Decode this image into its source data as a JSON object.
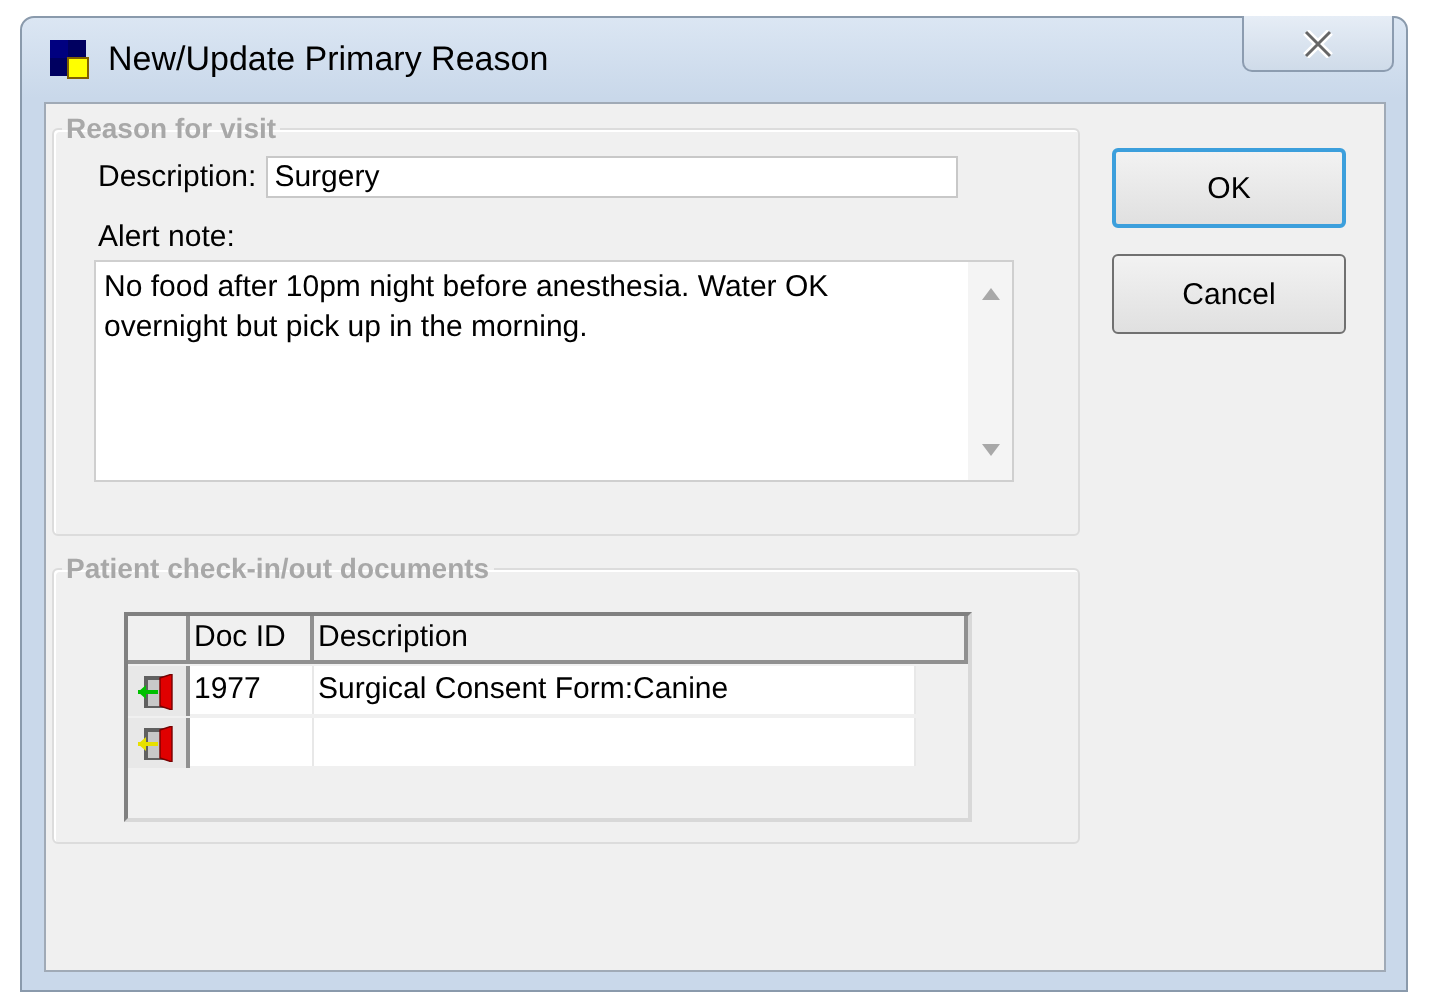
{
  "window": {
    "title": "New/Update Primary Reason"
  },
  "reason_group": {
    "title": "Reason for visit",
    "description_label": "Description:",
    "description_value": "Surgery",
    "alert_label": "Alert note:",
    "alert_value": "No food after 10pm night before anesthesia. Water OK overnight but pick up in the morning."
  },
  "documents_group": {
    "title": "Patient check-in/out documents",
    "table": {
      "columns": [
        "Doc ID",
        "Description"
      ],
      "rows": [
        {
          "color": "#00c000",
          "cells": [
            "1977",
            "Surgical Consent Form:Canine"
          ]
        },
        {
          "color": "#e8e000",
          "cells": [
            "",
            ""
          ]
        }
      ]
    }
  },
  "buttons": [
    {
      "label": "OK",
      "default": true
    },
    {
      "label": "Cancel",
      "default": false
    }
  ]
}
